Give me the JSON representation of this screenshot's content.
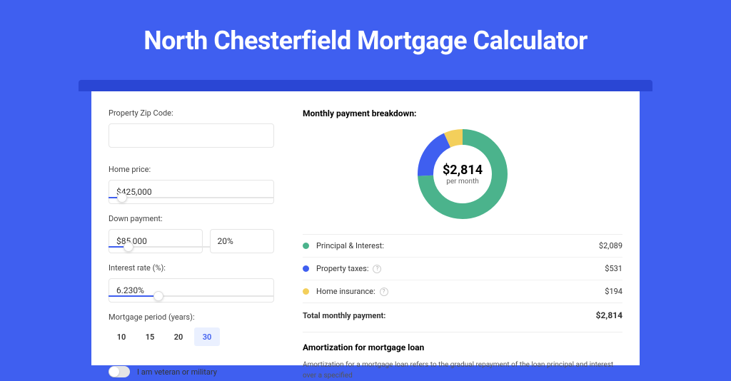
{
  "title": "North Chesterfield Mortgage Calculator",
  "form": {
    "zip_label": "Property Zip Code:",
    "zip_value": "",
    "home_price_label": "Home price:",
    "home_price_value": "$425,000",
    "down_payment_label": "Down payment:",
    "down_payment_value": "$85,000",
    "down_payment_pct": "20%",
    "rate_label": "Interest rate (%):",
    "rate_value": "6.230%",
    "period_label": "Mortgage period (years):",
    "periods": [
      "10",
      "15",
      "20",
      "30"
    ],
    "period_selected": "30",
    "veteran_label": "I am veteran or military"
  },
  "breakdown": {
    "title": "Monthly payment breakdown:",
    "total_amount": "$2,814",
    "per_month": "per month",
    "items": [
      {
        "label": "Principal & Interest:",
        "value": "$2,089",
        "color": "#4bb38c"
      },
      {
        "label": "Property taxes:",
        "value": "$531",
        "color": "#3f5ff0",
        "help": true
      },
      {
        "label": "Home insurance:",
        "value": "$194",
        "color": "#f3cf5b",
        "help": true
      }
    ],
    "total_label": "Total monthly payment:",
    "total_value": "$2,814"
  },
  "chart_data": {
    "type": "pie",
    "title": "Monthly payment breakdown",
    "series": [
      {
        "name": "Principal & Interest",
        "value": 2089,
        "color": "#4bb38c"
      },
      {
        "name": "Property taxes",
        "value": 531,
        "color": "#3f5ff0"
      },
      {
        "name": "Home insurance",
        "value": 194,
        "color": "#f3cf5b"
      }
    ],
    "total": 2814,
    "center_label": "$2,814",
    "center_sub": "per month"
  },
  "amortization": {
    "title": "Amortization for mortgage loan",
    "text": "Amortization for a mortgage loan refers to the gradual repayment of the loan principal and interest over a specified"
  },
  "sliders": {
    "home_price_pct": 8,
    "down_payment_pct": 20,
    "rate_pct": 30
  }
}
